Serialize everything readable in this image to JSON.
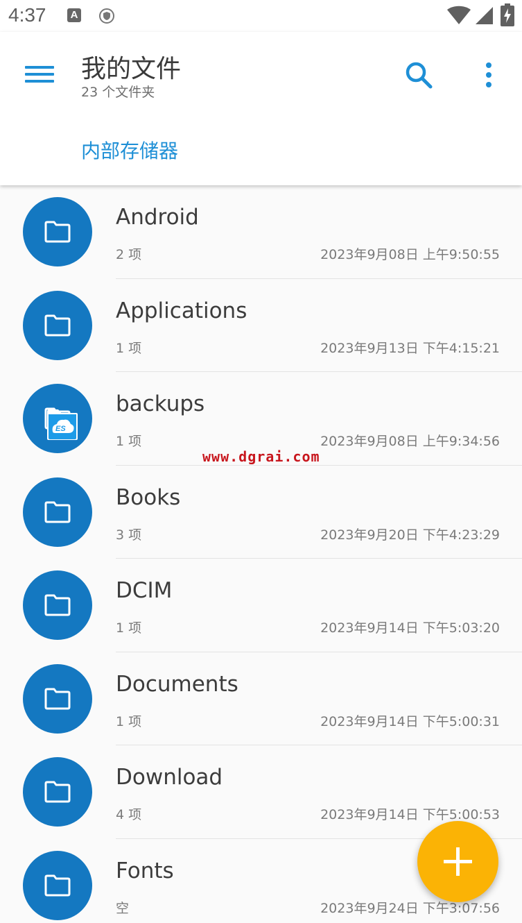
{
  "status_bar": {
    "time": "4:37",
    "a_label": "A"
  },
  "app_bar": {
    "title": "我的文件",
    "subtitle": "23 个文件夹",
    "breadcrumb": "内部存储器",
    "accent_color": "#1e8fd6"
  },
  "files": [
    {
      "name": "Android",
      "count": "2 项",
      "date": "2023年9月08日 上午9:50:55"
    },
    {
      "name": "Applications",
      "count": "1 项",
      "date": "2023年9月13日 下午4:15:21"
    },
    {
      "name": "backups",
      "count": "1 项",
      "date": "2023年9月08日 上午9:34:56"
    },
    {
      "name": "Books",
      "count": "3 项",
      "date": "2023年9月20日 下午4:23:29"
    },
    {
      "name": "DCIM",
      "count": "1 项",
      "date": "2023年9月14日 下午5:03:20"
    },
    {
      "name": "Documents",
      "count": "1 项",
      "date": "2023年9月14日 下午5:00:31"
    },
    {
      "name": "Download",
      "count": "4 项",
      "date": "2023年9月14日 下午5:00:53"
    },
    {
      "name": "Fonts",
      "count": "空",
      "date": "2023年9月24日 下午3:07:56"
    }
  ],
  "watermark": "www.dgrai.com",
  "colors": {
    "folder_circle": "#1478c1",
    "fab": "#fbb305"
  },
  "icons": {
    "menu": "menu-icon",
    "search": "search-icon",
    "more": "more-vert-icon",
    "folder": "folder-icon",
    "fab": "plus-icon"
  }
}
